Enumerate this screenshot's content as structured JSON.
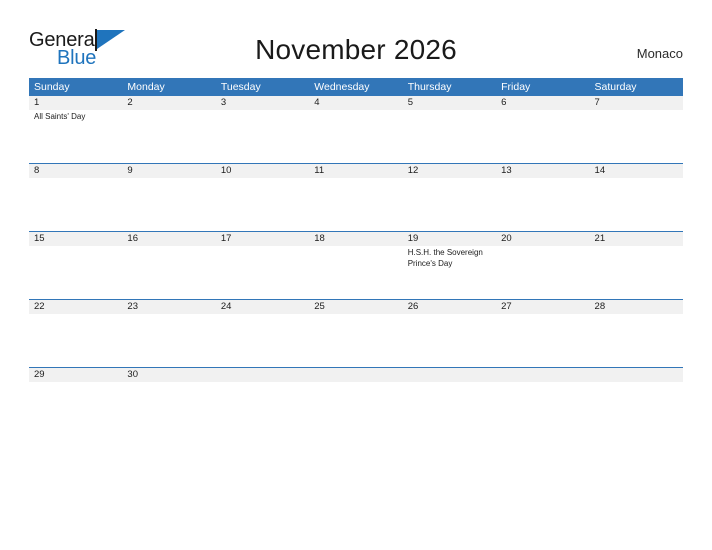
{
  "brand": {
    "name_part1": "General",
    "name_part2": "Blue",
    "accent_color": "#1f74bd"
  },
  "header": {
    "title": "November 2026",
    "country": "Monaco"
  },
  "calendar": {
    "header_bg_color": "#3276b8",
    "date_band_color": "#f1f1f1",
    "weekdays": [
      "Sunday",
      "Monday",
      "Tuesday",
      "Wednesday",
      "Thursday",
      "Friday",
      "Saturday"
    ],
    "weeks": [
      [
        {
          "date": "1",
          "events": [
            "All Saints' Day"
          ]
        },
        {
          "date": "2",
          "events": []
        },
        {
          "date": "3",
          "events": []
        },
        {
          "date": "4",
          "events": []
        },
        {
          "date": "5",
          "events": []
        },
        {
          "date": "6",
          "events": []
        },
        {
          "date": "7",
          "events": []
        }
      ],
      [
        {
          "date": "8",
          "events": []
        },
        {
          "date": "9",
          "events": []
        },
        {
          "date": "10",
          "events": []
        },
        {
          "date": "11",
          "events": []
        },
        {
          "date": "12",
          "events": []
        },
        {
          "date": "13",
          "events": []
        },
        {
          "date": "14",
          "events": []
        }
      ],
      [
        {
          "date": "15",
          "events": []
        },
        {
          "date": "16",
          "events": []
        },
        {
          "date": "17",
          "events": []
        },
        {
          "date": "18",
          "events": []
        },
        {
          "date": "19",
          "events": [
            "H.S.H. the Sovereign Prince's Day"
          ]
        },
        {
          "date": "20",
          "events": []
        },
        {
          "date": "21",
          "events": []
        }
      ],
      [
        {
          "date": "22",
          "events": []
        },
        {
          "date": "23",
          "events": []
        },
        {
          "date": "24",
          "events": []
        },
        {
          "date": "25",
          "events": []
        },
        {
          "date": "26",
          "events": []
        },
        {
          "date": "27",
          "events": []
        },
        {
          "date": "28",
          "events": []
        }
      ],
      [
        {
          "date": "29",
          "events": []
        },
        {
          "date": "30",
          "events": []
        },
        {
          "date": "",
          "events": []
        },
        {
          "date": "",
          "events": []
        },
        {
          "date": "",
          "events": []
        },
        {
          "date": "",
          "events": []
        },
        {
          "date": "",
          "events": []
        }
      ]
    ]
  }
}
